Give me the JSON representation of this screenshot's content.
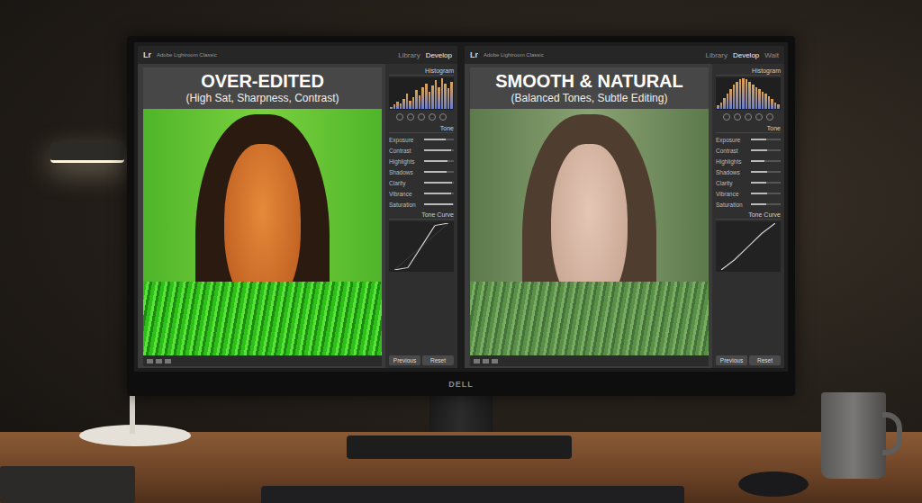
{
  "monitor": {
    "brand": "DELL"
  },
  "panels": [
    {
      "logo": "Lr",
      "app_name": "Adobe Lightroom Classic",
      "modules": [
        {
          "label": "Library",
          "selected": false
        },
        {
          "label": "Develop",
          "selected": true
        }
      ],
      "title": "OVER-EDITED",
      "subtitle": "(High Sat, Sharpness, Contrast)",
      "photo_kind": "over-edited",
      "histogram_label": "Histogram",
      "histogram": [
        2,
        5,
        9,
        6,
        12,
        18,
        10,
        14,
        22,
        16,
        25,
        30,
        20,
        28,
        34,
        26,
        36,
        30,
        24,
        32
      ],
      "section": "Tone",
      "sliders": [
        {
          "label": "Exposure",
          "level": 0.72
        },
        {
          "label": "Contrast",
          "level": 0.9
        },
        {
          "label": "Highlights",
          "level": 0.8
        },
        {
          "label": "Shadows",
          "level": 0.75
        },
        {
          "label": "Clarity",
          "level": 0.95
        },
        {
          "label": "Vibrance",
          "level": 0.92
        },
        {
          "label": "Saturation",
          "level": 0.96
        }
      ],
      "curve_label": "Tone Curve",
      "curve": [
        0,
        0.05,
        0.5,
        0.95,
        1
      ],
      "footer_buttons": [
        "Previous",
        "Reset"
      ]
    },
    {
      "logo": "Lr",
      "app_name": "Adobe Lightroom Classic",
      "modules": [
        {
          "label": "Library",
          "selected": false
        },
        {
          "label": "Develop",
          "selected": true
        },
        {
          "label": "Wait",
          "selected": false
        }
      ],
      "title": "SMOOTH & NATURAL",
      "subtitle": "(Balanced Tones, Subtle Editing)",
      "photo_kind": "natural",
      "histogram_label": "Histogram",
      "histogram": [
        3,
        6,
        10,
        14,
        18,
        22,
        25,
        27,
        28,
        27,
        25,
        22,
        20,
        18,
        16,
        14,
        12,
        9,
        6,
        4
      ],
      "section": "Tone",
      "sliders": [
        {
          "label": "Exposure",
          "level": 0.52
        },
        {
          "label": "Contrast",
          "level": 0.55
        },
        {
          "label": "Highlights",
          "level": 0.45
        },
        {
          "label": "Shadows",
          "level": 0.55
        },
        {
          "label": "Clarity",
          "level": 0.52
        },
        {
          "label": "Vibrance",
          "level": 0.55
        },
        {
          "label": "Saturation",
          "level": 0.5
        }
      ],
      "curve_label": "Tone Curve",
      "curve": [
        0,
        0.22,
        0.5,
        0.78,
        1
      ],
      "footer_buttons": [
        "Previous",
        "Reset"
      ]
    }
  ]
}
